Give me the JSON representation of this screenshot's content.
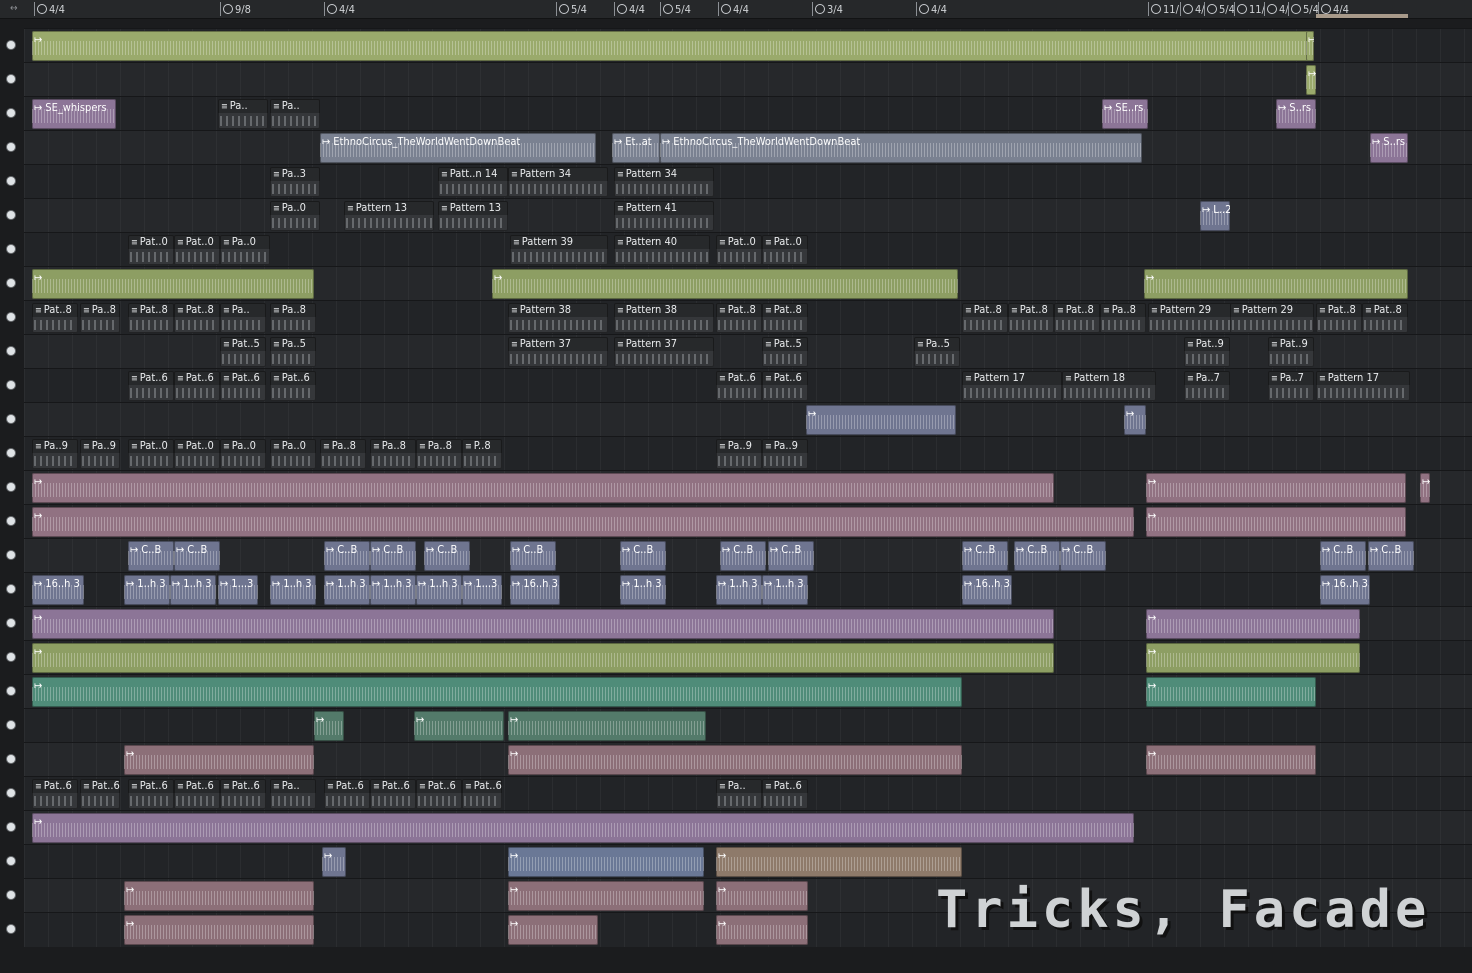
{
  "ruler": {
    "scroll_icon": "double-arrow-icon",
    "time_signatures": [
      "4/4",
      "9/8",
      "4/4",
      "5/4",
      "4/4",
      "5/4",
      "4/4",
      "3/4",
      "4/4",
      "11/",
      "4/",
      "5/4",
      "11/",
      "4/",
      "5/4",
      "4/4"
    ]
  },
  "tracks": [
    {
      "clips": [
        "",
        "",
        ""
      ]
    },
    {
      "clips": [
        ""
      ]
    },
    {
      "clips": [
        "SE_whispers",
        "Pa..",
        "Pa..",
        "SE..rs",
        "S..rs"
      ]
    },
    {
      "clips": [
        "EthnoCircus_TheWorldWentDownBeat",
        "Et..at",
        "EthnoCircus_TheWorldWentDownBeat",
        "S..rs"
      ]
    },
    {
      "clips": [
        "Pa..3",
        "Patt..n 14",
        "Pattern 34",
        "Pattern 34"
      ]
    },
    {
      "clips": [
        "Pa..0",
        "Pattern 13",
        "Pattern 13",
        "Pattern 41",
        "L..2"
      ]
    },
    {
      "clips": [
        "Pat..0",
        "Pat..0",
        "Pa..0",
        "Pattern 39",
        "Pattern 40",
        "Pat..0",
        "Pat..0"
      ]
    },
    {
      "clips": [
        "",
        "",
        ""
      ]
    },
    {
      "clips": [
        "Pat..8",
        "Pa..8",
        "Pat..8",
        "Pat..8",
        "Pa..",
        "Pa..8",
        "Pattern 38",
        "Pattern 38",
        "Pat..8",
        "Pat..8",
        "Pat..8",
        "Pat..8",
        "Pat..8",
        "Pa..8",
        "Pattern 29",
        "Pattern 29",
        "Pat..8",
        "Pat..8"
      ]
    },
    {
      "clips": [
        "Pat..5",
        "Pa..5",
        "Pattern 37",
        "Pattern 37",
        "Pat..5",
        "Pa..5",
        "Pat..9",
        "Pat..9"
      ]
    },
    {
      "clips": [
        "Pat..6",
        "Pat..6",
        "Pat..6",
        "Pat..6",
        "Pat..6",
        "Pat..6",
        "Pattern 17",
        "Pattern 18",
        "Pa..7",
        "Pa..7",
        "Pattern 17"
      ]
    },
    {
      "clips": [
        "",
        "",
        ""
      ]
    },
    {
      "clips": [
        "Pa..9",
        "Pa..9",
        "Pat..0",
        "Pat..0",
        "Pa..0",
        "Pa..0",
        "Pa..8",
        "Pa..8",
        "Pa..8",
        "P..8",
        "Pa..9",
        "Pa..9"
      ]
    },
    {
      "clips": [
        "",
        "",
        ""
      ]
    },
    {
      "clips": [
        "",
        "",
        ""
      ]
    },
    {
      "clips": [
        "C..B",
        "C..B",
        "C..B",
        "C..B",
        "C..B",
        "C..B",
        "C..B",
        "C..B",
        "C..B",
        "C..B",
        "C..B",
        "C..B",
        "C..B",
        "C..B"
      ]
    },
    {
      "clips": [
        "16..h 3",
        "1..h 3",
        "1..h 3",
        "1...3",
        "1..h 3",
        "1..h 3",
        "1..h 3",
        "1..h 3",
        "1...3",
        "16..h 3",
        "1..h 3",
        "1..h 3",
        "1..h 3",
        "16..h 3",
        "16..h 3"
      ]
    },
    {
      "clips": [
        "",
        "",
        ""
      ]
    },
    {
      "clips": [
        "",
        "",
        ""
      ]
    },
    {
      "clips": [
        "",
        "",
        ""
      ]
    },
    {
      "clips": [
        "",
        "",
        ""
      ]
    },
    {
      "clips": [
        "",
        "",
        ""
      ]
    },
    {
      "clips": [
        "Pat..6",
        "Pat..6",
        "Pat..6",
        "Pat..6",
        "Pat..6",
        "Pa..",
        "Pat..6",
        "Pat..6",
        "Pat..6",
        "Pat..6",
        "Pa..",
        "Pat..6",
        "Pat..6"
      ]
    },
    {
      "clips": [
        "",
        "",
        ""
      ]
    },
    {
      "clips": [
        "",
        "",
        ""
      ]
    },
    {
      "clips": [
        "",
        "",
        ""
      ]
    },
    {
      "clips": [
        "",
        "",
        ""
      ]
    }
  ],
  "watermark": "Tricks, Facade"
}
